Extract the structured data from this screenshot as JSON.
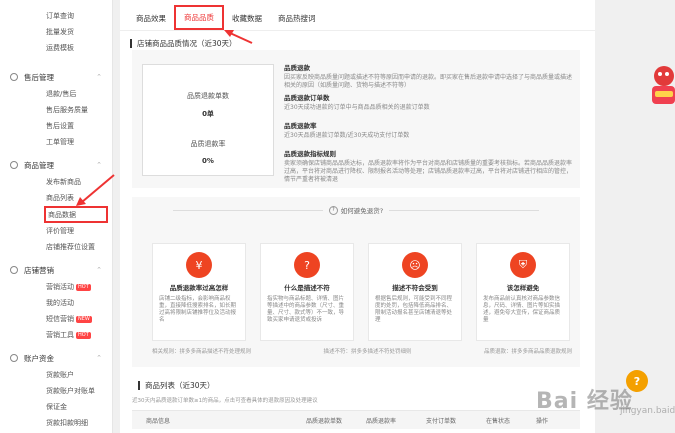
{
  "sidebar": {
    "top_items": [
      "订单查询",
      "批量发货",
      "运费模板"
    ],
    "groups": [
      {
        "title": "售后管理",
        "items": [
          "退款/售后",
          "售后服务质量",
          "售后设置",
          "工单管理"
        ]
      },
      {
        "title": "商品管理",
        "items": [
          "发布新商品",
          "商品列表",
          "商品数据",
          "评价管理",
          "店铺推荐位设置"
        ]
      },
      {
        "title": "店铺营销",
        "items": [
          "营销活动",
          "我的活动",
          "短信营销",
          "营销工具"
        ]
      },
      {
        "title": "账户资金",
        "items": [
          "货款账户",
          "货款账户对账单",
          "保证金",
          "货款扣款明细"
        ]
      }
    ],
    "badges": {
      "hot": "HOT",
      "new": "NEW"
    }
  },
  "tabs": [
    "商品效果",
    "商品品质",
    "收藏数据",
    "商品热搜词"
  ],
  "quality": {
    "section_title": "店铺商品品质情况（近30天）",
    "refund_count_label": "品质退款单数",
    "refund_count_value": "0单",
    "refund_rate_label": "品质退款率",
    "refund_rate_value": "0%",
    "defs": [
      {
        "title": "品质退款",
        "text": "因买家反映商品质量问题或描述不符等原因而申请的退款。即买家在售后退款申请中选择了与商品质量或描述相关的原因（如质量问题、货物与描述不符等）"
      },
      {
        "title": "品质退款订单数",
        "text": "近30天成功退款的订单中与商品品质相关的退款订单数"
      },
      {
        "title": "品质退款率",
        "text": "近30天品质退款订单数/近30天成功支付订单数"
      },
      {
        "title": "品质退款指标规则",
        "text": "卖家须确保店铺商品品质达标，品质退款率将作为平台对商品和店铺质量的重要考核指标。若商品品质退款率过高，平台将对商品进行降权、限制报名活动等处理；店铺品质退款率过高，平台将对店铺进行相应的管控，情节严重者将被清退"
      }
    ]
  },
  "advice": {
    "heading": "如何避免退货?",
    "cards": [
      {
        "icon": "¥",
        "title": "品质退款率过高怎样",
        "desc": "店铺二级指标，会影响商品权重，直接降低搜索排名，如长期过高将限制店铺推荐位及活动报名"
      },
      {
        "icon": "?",
        "title": "什么是描述不符",
        "desc": "指实物与商品标题、详情、图片等描述中的商品参数（尺寸、重量、尺寸、款式等）不一致，导致买家申请退货或投诉"
      },
      {
        "icon": "☹",
        "title": "描述不符会受到",
        "desc": "根据售后规则，可能受到不同程度的处罚，包括降低商品排名、限制活动报名甚至店铺清退等处理"
      },
      {
        "icon": "⛨",
        "title": "该怎样避免",
        "desc": "发布商品前认真核对商品参数信息，尺码、详情、图片等如实描述，避免夸大宣传，保证商品质量"
      }
    ],
    "links": [
      "相关规则：拼多多商品描述不符处理规则",
      "描述不符：拼多多描述不符处罚细则",
      "品质退款：拼多多商品品质退款规则"
    ]
  },
  "product_list": {
    "title": "商品列表（近30天）",
    "note": "近30天内品质退款订单数≥1的商品，点击可查看具体的退款原因及处理建议",
    "columns": [
      "商品信息",
      "品质退款单数",
      "品质退款率",
      "支付订单数",
      "在售状态",
      "操作"
    ]
  },
  "help_icon_label": "?",
  "watermark": {
    "text": "Bai 经验",
    "sub": "jingyan.baidu.com"
  },
  "colors": {
    "accent": "#e33333",
    "icon_red": "#ee4422",
    "help": "#f4a000"
  }
}
